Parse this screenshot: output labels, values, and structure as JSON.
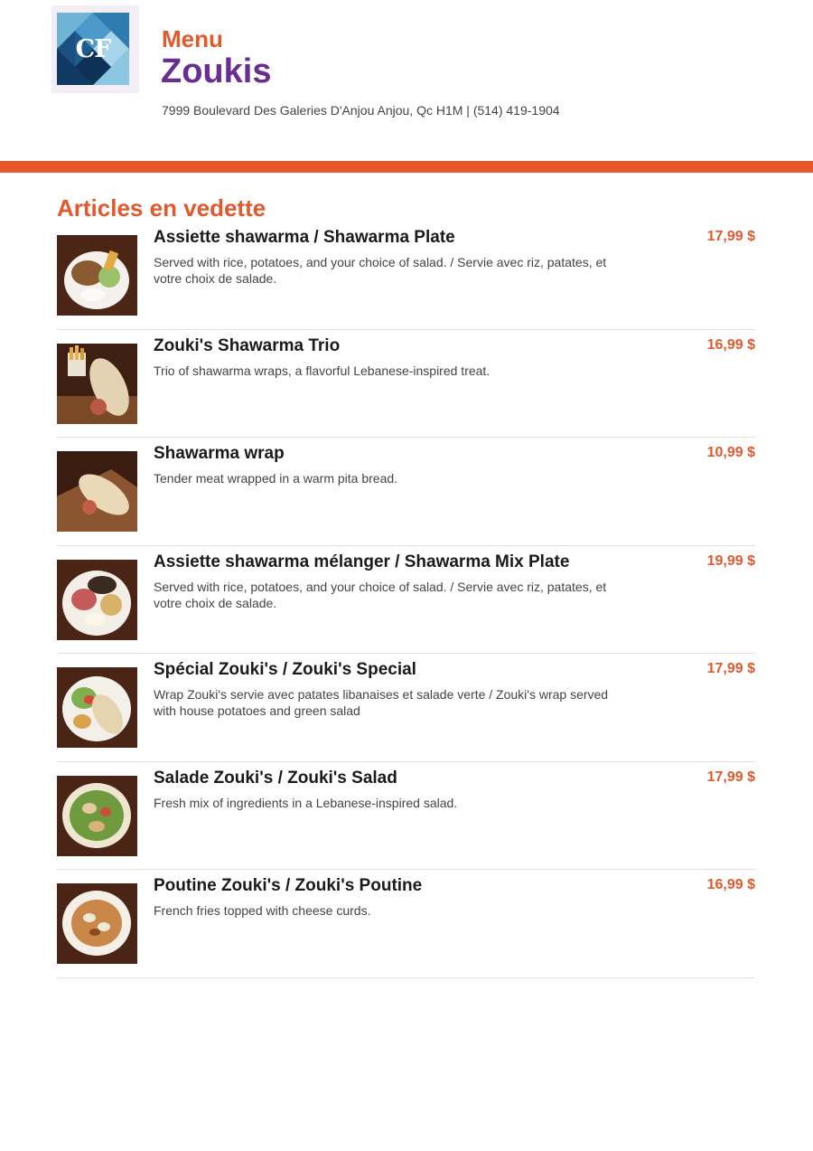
{
  "header": {
    "logo_text": "CF",
    "subtitle": "Menu",
    "title": "Zoukis",
    "address": "7999 Boulevard Des Galeries D'Anjou Anjou, Qc H1M | (514) 419-1904"
  },
  "section": {
    "title": "Articles en vedette"
  },
  "items": [
    {
      "name": "Assiette shawarma / Shawarma Plate",
      "description": "Served with rice, potatoes, and your choice of salad. / Servie avec riz, patates, et votre choix de salade.",
      "price": "17,99 $",
      "image": "plate"
    },
    {
      "name": "Zouki's Shawarma Trio",
      "description": "Trio of shawarma wraps, a flavorful Lebanese-inspired treat.",
      "price": "16,99 $",
      "image": "wrap-fries"
    },
    {
      "name": "Shawarma wrap",
      "description": "Tender meat wrapped in a warm pita bread.",
      "price": "10,99 $",
      "image": "wrap-board"
    },
    {
      "name": "Assiette shawarma mélanger / Shawarma Mix Plate",
      "description": "Served with rice, potatoes, and your choice of salad. / Servie avec riz, patates, et votre choix de salade.",
      "price": "19,99 $",
      "image": "mix-plate"
    },
    {
      "name": "Spécial Zouki's / Zouki's Special",
      "description": "Wrap Zouki's servie avec patates libanaises et salade verte / Zouki's wrap served with house potatoes and green salad",
      "price": "17,99 $",
      "image": "special"
    },
    {
      "name": "Salade Zouki's / Zouki's Salad",
      "description": "Fresh mix of ingredients in a Lebanese-inspired salad.",
      "price": "17,99 $",
      "image": "salad"
    },
    {
      "name": "Poutine Zouki's / Zouki's Poutine",
      "description": "French fries topped with cheese curds.",
      "price": "16,99 $",
      "image": "poutine"
    }
  ],
  "colors": {
    "accent": "#e1592c",
    "brand": "#6a2d91",
    "bar": "#e8582c"
  }
}
